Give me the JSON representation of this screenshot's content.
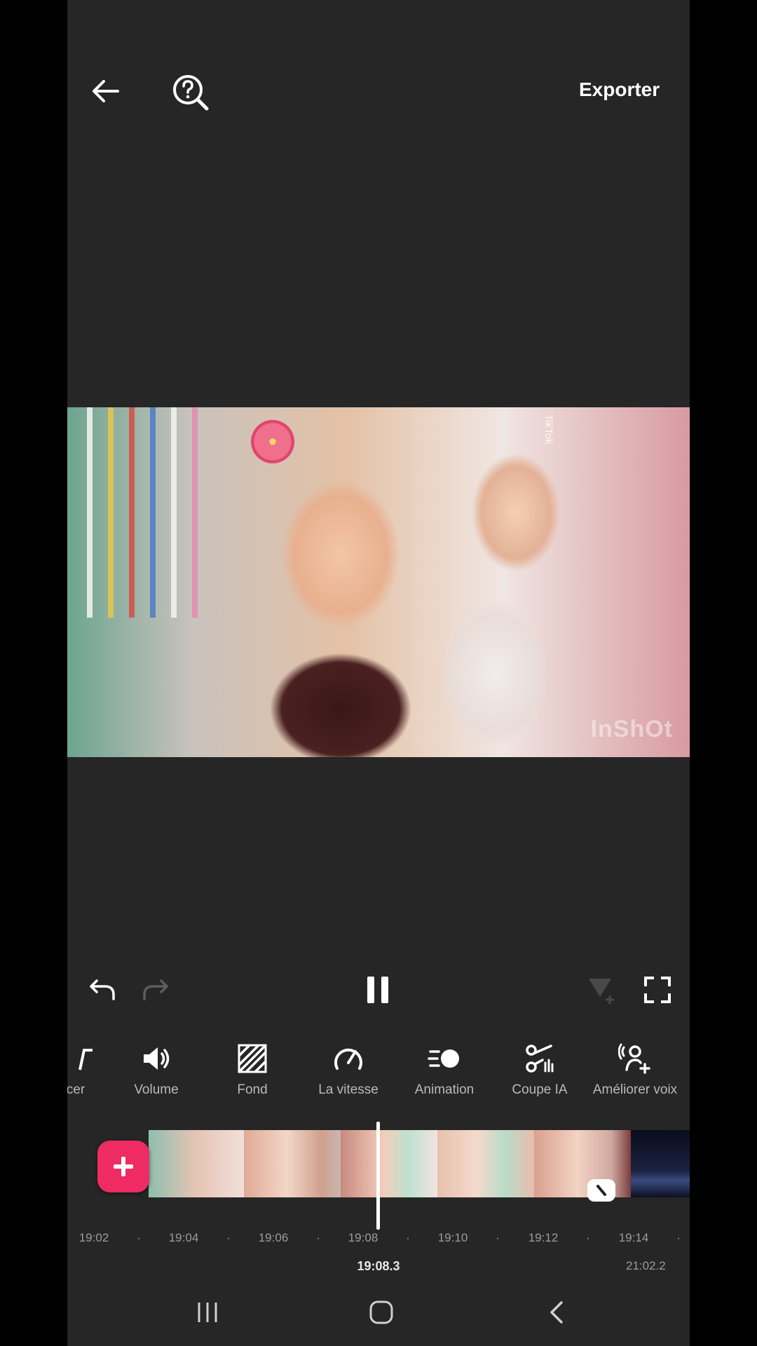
{
  "header": {
    "back_icon": "arrow-left-icon",
    "help_icon": "help-search-icon",
    "export_label": "Exporter"
  },
  "preview": {
    "watermark_text": "InShOt",
    "tiktok_label": "TikTok"
  },
  "controls": {
    "undo_icon": "undo-icon",
    "redo_icon": "redo-icon",
    "play_state_icon": "pause-icon",
    "keyframe_icon": "keyframe-add-icon",
    "fullscreen_icon": "fullscreen-icon"
  },
  "tools": [
    {
      "label": "cer",
      "icon": "partial-tool-icon"
    },
    {
      "label": "Volume",
      "icon": "volume-icon"
    },
    {
      "label": "Fond",
      "icon": "background-stripes-icon"
    },
    {
      "label": "La vitesse",
      "icon": "speed-gauge-icon"
    },
    {
      "label": "Animation",
      "icon": "animation-icon"
    },
    {
      "label": "Coupe IA",
      "icon": "ai-cut-icon"
    },
    {
      "label": "Améliorer voix",
      "icon": "voice-enhance-icon"
    }
  ],
  "timeline": {
    "ruler_labels": [
      "19:02",
      "19:04",
      "19:06",
      "19:08",
      "19:10",
      "19:12",
      "19:14"
    ],
    "current_time": "19:08.3",
    "total_time": "21:02.2"
  },
  "colors": {
    "app_bg": "#262626",
    "accent": "#ee2b62",
    "label_gray": "#b9b9b9"
  }
}
